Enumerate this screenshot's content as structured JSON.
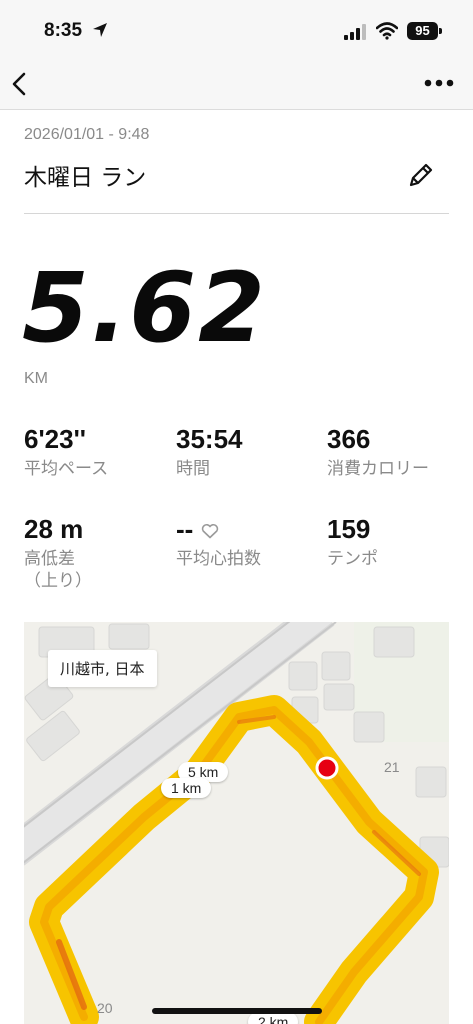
{
  "status_bar": {
    "time": "8:35",
    "battery": "95",
    "icons": [
      "location-arrow-icon",
      "signal-bars-icon",
      "wifi-icon",
      "battery-icon"
    ]
  },
  "nav": {
    "back_icon": "chevron-left-icon",
    "more_icon": "ellipsis-icon"
  },
  "activity": {
    "date": "2026/01/01 - 9:48",
    "title": "木曜日 ラン",
    "edit_icon": "pencil-icon",
    "distance": "5.62",
    "distance_unit": "KM"
  },
  "stats": [
    {
      "value": "6'23''",
      "label": "平均ペース"
    },
    {
      "value": "35:54",
      "label": "時間"
    },
    {
      "value": "366",
      "label": "消費カロリー"
    },
    {
      "value": "28 m",
      "label": "高低差\n（上り）"
    },
    {
      "value": "--",
      "label": "平均心拍数",
      "icon": "heart-outline-icon"
    },
    {
      "value": "159",
      "label": "テンポ"
    }
  ],
  "map": {
    "location": "川越市, 日本",
    "km_markers": [
      "5 km",
      "1 km",
      "2 km"
    ],
    "block_numbers": [
      "21",
      "20"
    ],
    "route_colors": [
      "#f7c400",
      "#f2a400",
      "#e46a10"
    ],
    "current_marker_color": "#e60012"
  }
}
